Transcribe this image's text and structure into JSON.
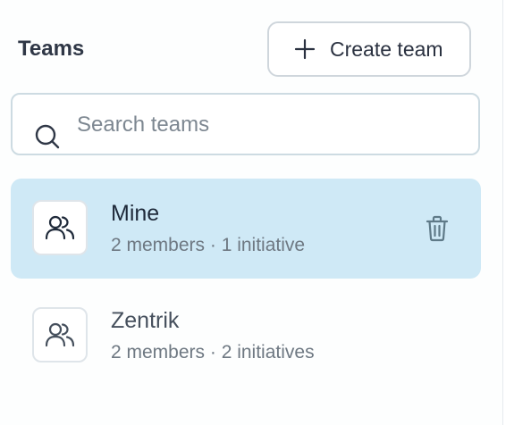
{
  "header": {
    "title": "Teams",
    "create_button_label": "Create team"
  },
  "search": {
    "placeholder": "Search teams",
    "value": ""
  },
  "teams": [
    {
      "name": "Mine",
      "members": "2 members",
      "initiatives": "1 initiative",
      "meta": "2 members · 1 initiative",
      "selected": true
    },
    {
      "name": "Zentrik",
      "members": "2 members",
      "initiatives": "2 initiatives",
      "meta": "2 members · 2 initiatives",
      "selected": false
    }
  ],
  "icons": {
    "create": "plus-icon",
    "search": "search-icon",
    "team": "users-icon",
    "delete": "trash-icon"
  },
  "colors": {
    "selected_background": "#cfe9f6",
    "border": "#cfd6dc",
    "text_primary": "#2a3140",
    "text_secondary": "#6e7882"
  }
}
